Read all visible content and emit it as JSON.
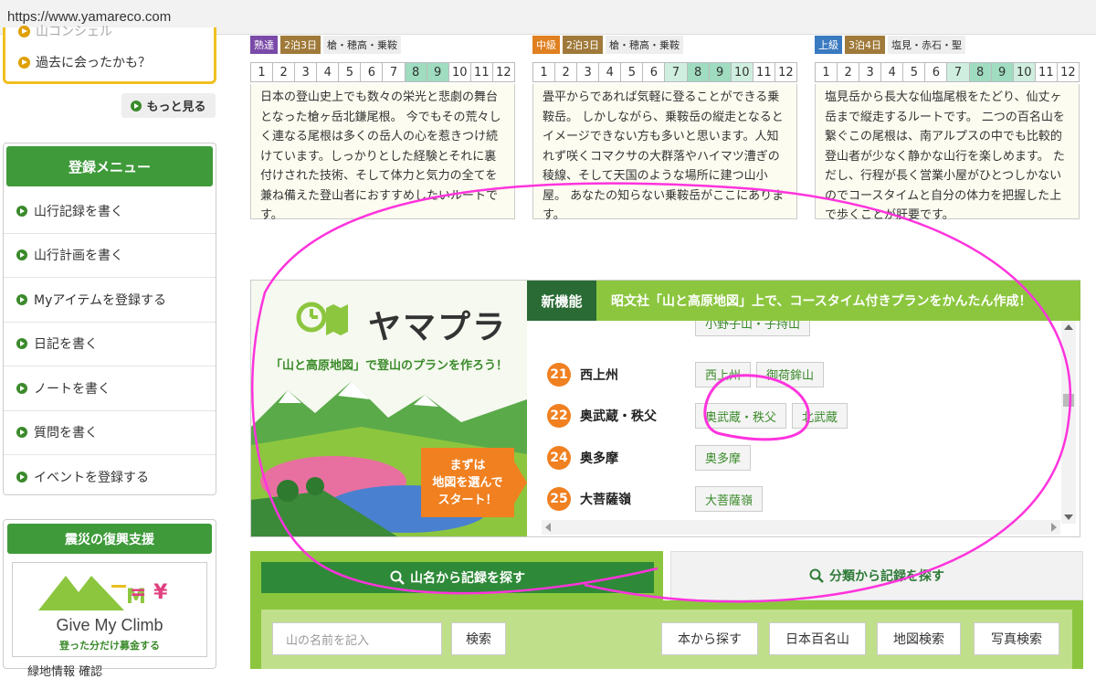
{
  "browser": {
    "url": "https://www.yamareco.com"
  },
  "pickup": {
    "item_cut": "山コンシェル",
    "item2": "過去に会ったかも？"
  },
  "more_label": "もっと見る",
  "register_menu": {
    "title": "登録メニュー",
    "items": [
      "山行記録を書く",
      "山行計画を書く",
      "Myアイテムを登録する",
      "日記を書く",
      "ノートを書く",
      "質問を書く",
      "イベントを登録する"
    ]
  },
  "disaster": {
    "title": "震災の復興支援",
    "banner_text": "Give My Climb",
    "banner_sub": "登った分だけ募金する",
    "symbols": "M = ¥"
  },
  "bottom_left_text": "緑地情報 確認",
  "month_labels": [
    "1",
    "2",
    "3",
    "4",
    "5",
    "6",
    "7",
    "8",
    "9",
    "10",
    "11",
    "12"
  ],
  "courses": [
    {
      "level": "熟達",
      "level_color": "#7a4aa8",
      "days": "2泊3日",
      "area": "槍・穂高・乗鞍",
      "desc": "日本の登山史上でも数々の栄光と悲劇の舞台となった槍ヶ岳北鎌尾根。 今でもその荒々しく連なる尾根は多くの岳人の心を惹きつけ続けています。しっかりとした経験とそれに裏付けされた技術、そして体力と気力の全てを兼ね備えた登山者におすすめしたいルートです。"
    },
    {
      "level": "中級",
      "level_color": "#e08020",
      "days": "2泊3日",
      "area": "槍・穂高・乗鞍",
      "desc": "畳平からであれば気軽に登ることができる乗鞍岳。 しかしながら、乗鞍岳の縦走となるとイメージできない方も多いと思います。人知れず咲くコマクサの大群落やハイマツ漕ぎの稜線、そして天国のような場所に建つ山小屋。 あなたの知らない乗鞍岳がここにあります。"
    },
    {
      "level": "上級",
      "level_color": "#3a7ac0",
      "days": "3泊4日",
      "area": "塩見・赤石・聖",
      "desc": "塩見岳から長大な仙塩尾根をたどり、仙丈ヶ岳まで縦走するルートです。 二つの百名山を繋ぐこの尾根は、南アルプスの中でも比較的登山者が少なく静かな山行を楽しめます。 ただし、行程が長く営業小屋がひとつしかないのでコースタイムと自分の体力を把握した上で歩くことが肝要です。"
    }
  ],
  "yamapla": {
    "logo": "ヤマプラ",
    "subtitle": "「山と高原地図」で登山のプランを作ろう！",
    "start_label": "まずは\n地図を選んで\nスタート！",
    "badge": "新機能",
    "headline": "昭文社「山と高原地図」上で、コースタイム付きプランをかんたん作成！",
    "partial_tag": "小野子山・子持山",
    "rows": [
      {
        "num": "21",
        "name": "西上州",
        "tags": [
          "西上州",
          "御荷鉾山"
        ]
      },
      {
        "num": "22",
        "name": "奥武蔵・秩父",
        "tags": [
          "奥武蔵・秩父",
          "北武蔵"
        ]
      },
      {
        "num": "24",
        "name": "奥多摩",
        "tags": [
          "奥多摩"
        ]
      },
      {
        "num": "25",
        "name": "大菩薩嶺",
        "tags": [
          "大菩薩嶺"
        ]
      }
    ]
  },
  "search": {
    "tab_name": "山名から記録を探す",
    "tab_category": "分類から記録を探す",
    "placeholder": "山の名前を記入",
    "search_btn": "検索",
    "buttons": [
      "本から探す",
      "日本百名山",
      "地図検索",
      "写真検索"
    ]
  }
}
